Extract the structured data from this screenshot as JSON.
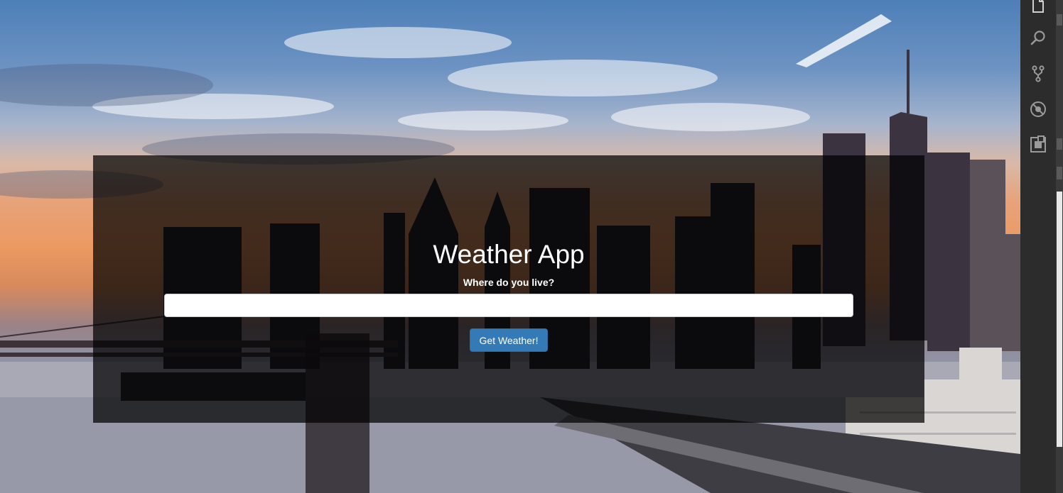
{
  "app": {
    "title": "Weather App",
    "prompt": "Where do you live?",
    "input_value": "",
    "button_label": "Get Weather!"
  },
  "colors": {
    "button": "#337ab7",
    "panel_overlay": "rgba(0,0,0,0.72)",
    "activity_bar": "#2c2c2c"
  },
  "activity_bar": {
    "icons": [
      "files-icon",
      "search-icon",
      "source-control-icon",
      "debug-icon",
      "extensions-icon"
    ]
  }
}
